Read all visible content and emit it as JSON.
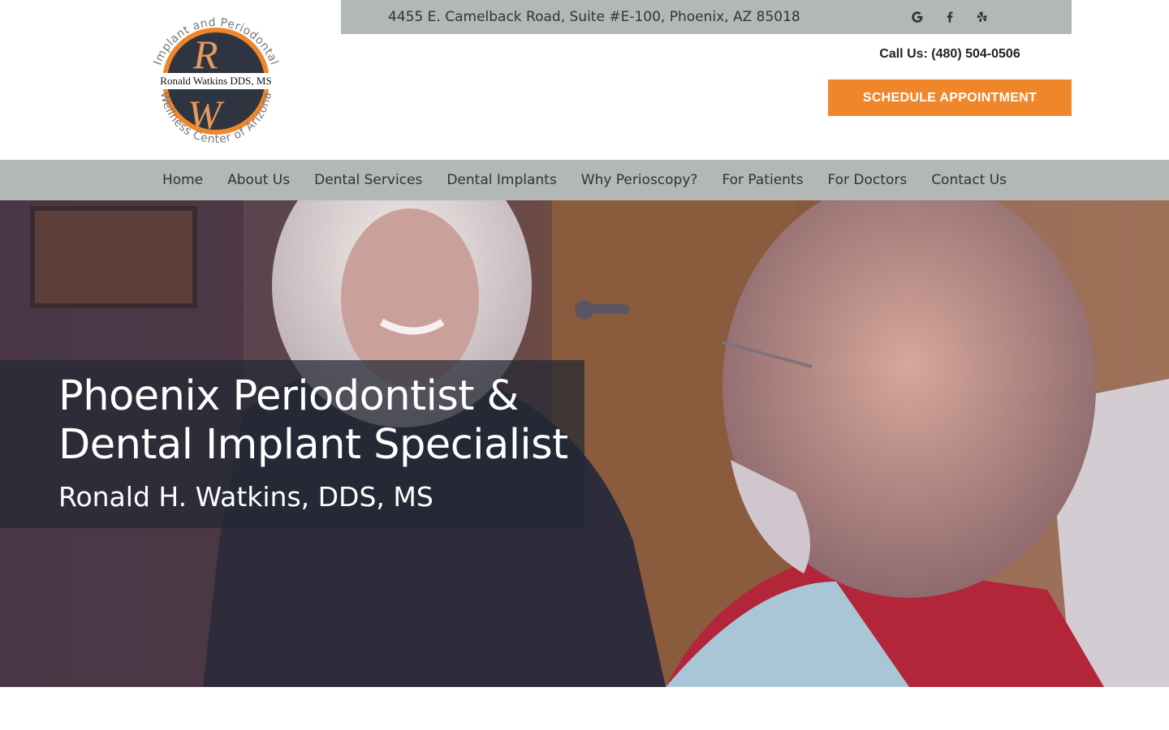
{
  "logo": {
    "arc_top": "Implant and Periodontal",
    "arc_bottom": "Wellness Center of Arizona",
    "name_band": "Ronald Watkins DDS, MS",
    "monogram_top": "R",
    "monogram_bottom": "W"
  },
  "topbar": {
    "address": "4455 E. Camelback Road, Suite #E-100, Phoenix, AZ 85018",
    "social": [
      {
        "name": "google-icon"
      },
      {
        "name": "facebook-icon"
      },
      {
        "name": "yelp-icon"
      }
    ]
  },
  "contact": {
    "call_label": "Call Us: (480) 504-0506",
    "schedule_button": "Schedule Appointment"
  },
  "nav": {
    "items": [
      "Home",
      "About Us",
      "Dental Services",
      "Dental Implants",
      "Why Perioscopy?",
      "For Patients",
      "For Doctors",
      "Contact Us"
    ]
  },
  "hero": {
    "title": "Phoenix Periodontist & Dental Implant Specialist",
    "subtitle": "Ronald H. Watkins, DDS, MS"
  },
  "colors": {
    "accent_orange": "#f0862a",
    "bar_gray": "#b3b7b6",
    "logo_dark": "#2f3540"
  }
}
